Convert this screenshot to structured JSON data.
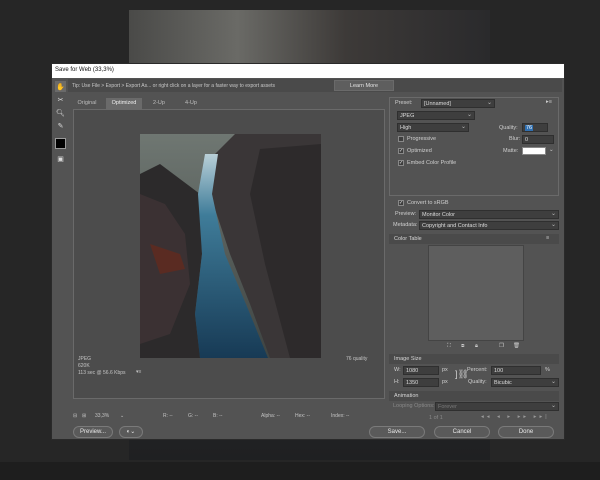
{
  "window": {
    "title": "Save for Web (33,3%)"
  },
  "tip": {
    "text": "Tip: Use File > Export > Export As... or right click on a layer for a faster way to export assets",
    "learn_more": "Learn More"
  },
  "tabs": [
    "Original",
    "Optimized",
    "2-Up",
    "4-Up"
  ],
  "tools": [
    "hand-icon",
    "slice-select-icon",
    "zoom-icon",
    "eyedropper-icon",
    "color-swatch",
    "toggle-slices-icon"
  ],
  "preview_info": {
    "format": "JPEG",
    "size": "620K",
    "time": "113 sec @ 56.6 Kbps",
    "quality": "76 quality"
  },
  "status": {
    "zoom": "33,3%",
    "r": "R: --",
    "g": "G: --",
    "b": "B: --",
    "alpha": "Alpha: --",
    "hex": "Hex: --",
    "index": "Index: --"
  },
  "buttons": {
    "preview": "Preview...",
    "save": "Save...",
    "cancel": "Cancel",
    "done": "Done"
  },
  "settings": {
    "preset_label": "Preset:",
    "preset": "[Unnamed]",
    "format": "JPEG",
    "quality_level": "High",
    "quality_label": "Quality:",
    "quality_value": "76",
    "progressive": "Progressive",
    "blur_label": "Blur:",
    "blur_value": "0",
    "optimized": "Optimized",
    "matte_label": "Matte:",
    "embed_profile": "Embed Color Profile",
    "convert_srgb": "Convert to sRGB",
    "preview_label": "Preview:",
    "preview_value": "Monitor Color",
    "metadata_label": "Metadata:",
    "metadata_value": "Copyright and Contact Info",
    "color_table": "Color Table"
  },
  "image_size": {
    "title": "Image Size",
    "w_label": "W:",
    "w": "1080",
    "h_label": "H:",
    "h": "1350",
    "unit": "px",
    "percent_label": "Percent:",
    "percent": "100",
    "percent_unit": "%",
    "quality_label": "Quality:",
    "quality": "Bicubic"
  },
  "animation": {
    "title": "Animation",
    "looping_label": "Looping Options:",
    "looping": "Forever",
    "frames": "1 of 1"
  },
  "colors": {
    "matte": "#ffffff",
    "swatch": "#000000"
  }
}
